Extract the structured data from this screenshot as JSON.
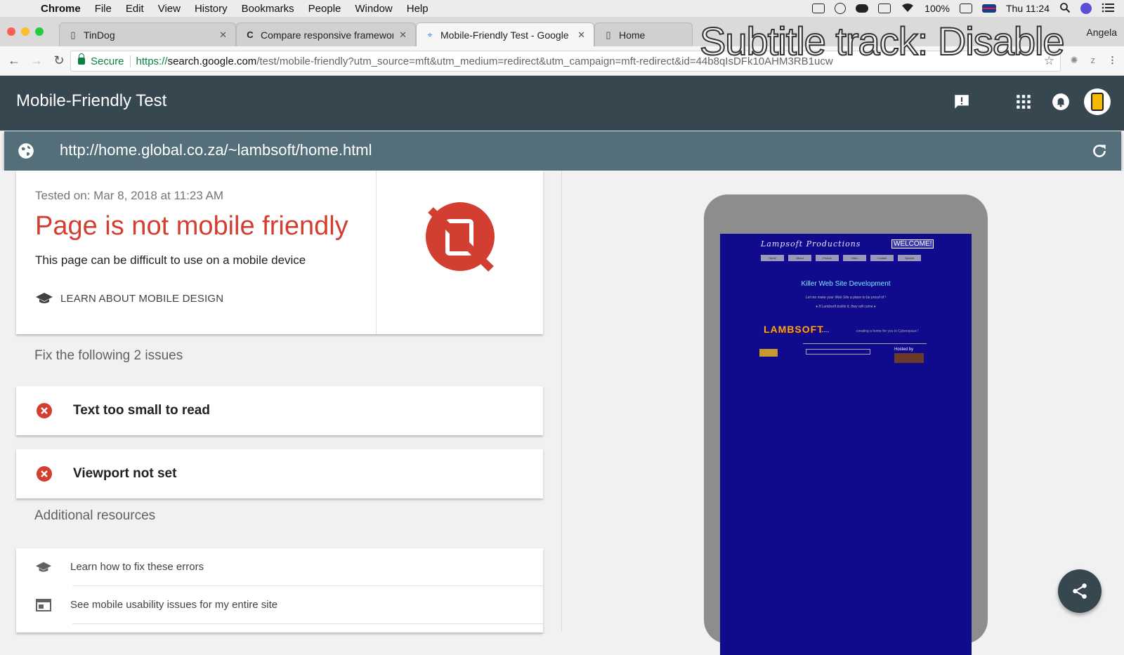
{
  "os_menubar": {
    "apple": "",
    "app": "Chrome",
    "items": [
      "File",
      "Edit",
      "View",
      "History",
      "Bookmarks",
      "People",
      "Window",
      "Help"
    ],
    "battery": "100%",
    "clock": "Thu 11:24"
  },
  "browser": {
    "tabs": [
      {
        "label": "TinDog",
        "icon": "page-icon"
      },
      {
        "label": "Compare responsive framewor",
        "icon": "c-icon"
      },
      {
        "label": "Mobile-Friendly Test - Google",
        "icon": "test-icon"
      },
      {
        "label": "Home",
        "icon": "page-icon"
      }
    ],
    "active_tab": 2,
    "profile": "Angela",
    "secure_label": "Secure",
    "url_scheme": "https://",
    "url_host": "search.google.com",
    "url_rest": "/test/mobile-friendly?utm_source=mft&utm_medium=redirect&utm_campaign=mft-redirect&id=44b8qIsDFk10AHM3RB1ucw"
  },
  "overlay": {
    "subtitle": "Subtitle track: Disable"
  },
  "app": {
    "title": "Mobile-Friendly Test",
    "tested_url": "http://home.global.co.za/~lambsoft/home.html"
  },
  "result": {
    "tested_on": "Tested on: Mar 8, 2018 at 11:23 AM",
    "verdict": "Page is not mobile friendly",
    "verdict_sub": "This page can be difficult to use on a mobile device",
    "learn_link": "LEARN ABOUT MOBILE DESIGN"
  },
  "issues": {
    "title": "Fix the following 2 issues",
    "items": [
      "Text too small to read",
      "Viewport not set"
    ]
  },
  "resources": {
    "title": "Additional resources",
    "items": [
      "Learn how to fix these errors",
      "See mobile usability issues for my entire site"
    ]
  },
  "preview": {
    "site_logo": "Lampsoft Productions",
    "site_welcome": "WELCOME!",
    "site_nav": [
      "Home",
      "About",
      "Photos",
      "Video",
      "Contact",
      "Special"
    ],
    "heading": "Killer Web Site Development",
    "tagline": "Let me make your Web Site a place to be proud of !",
    "tagline2": "♦ If Lambsoft builds it, they will come ♦",
    "brand": "LAMBSOFT",
    "brand_dots": "....",
    "brand_tag": "creating a home for you in Cyberspace !",
    "hosted": "Hosted by"
  },
  "colors": {
    "header": "#37474f",
    "url_bar": "#546e7a",
    "error_red": "#d23f31",
    "preview_bg": "#100a8c"
  }
}
